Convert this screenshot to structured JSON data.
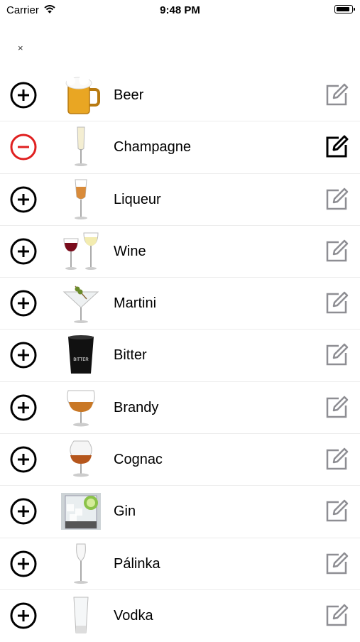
{
  "status_bar": {
    "carrier": "Carrier",
    "time": "9:48 PM"
  },
  "header": {
    "close_label": "×"
  },
  "drinks": [
    {
      "name": "Beer",
      "selected": false
    },
    {
      "name": "Champagne",
      "selected": true
    },
    {
      "name": "Liqueur",
      "selected": false
    },
    {
      "name": "Wine",
      "selected": false
    },
    {
      "name": "Martini",
      "selected": false
    },
    {
      "name": "Bitter",
      "selected": false
    },
    {
      "name": "Brandy",
      "selected": false
    },
    {
      "name": "Cognac",
      "selected": false
    },
    {
      "name": "Gin",
      "selected": false
    },
    {
      "name": "Pálinka",
      "selected": false
    },
    {
      "name": "Vodka",
      "selected": false
    }
  ],
  "colors": {
    "remove": "#e02020",
    "add": "#000000",
    "edit_inactive": "#8e8e93",
    "edit_active": "#000000"
  },
  "icons": {
    "add": "plus-circle-icon",
    "remove": "minus-circle-icon",
    "edit": "edit-icon"
  }
}
